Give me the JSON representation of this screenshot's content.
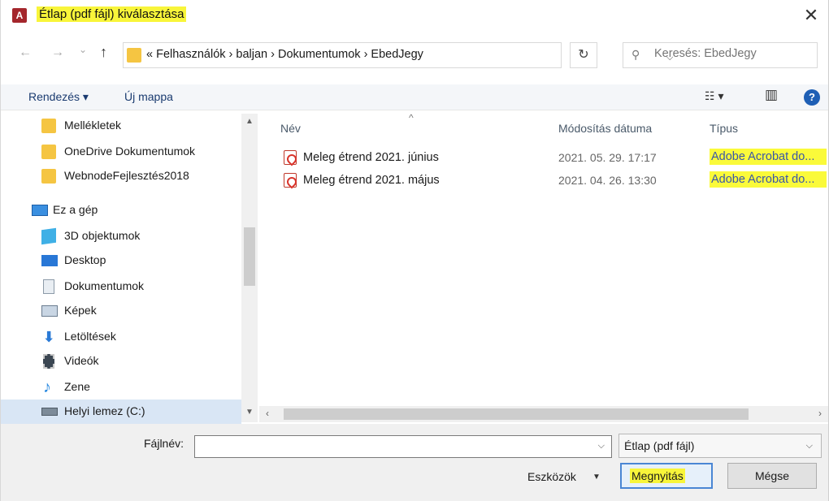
{
  "window": {
    "title": "Étlap (pdf fájl) kiválasztása",
    "app_icon_letter": "A",
    "close_glyph": "✕"
  },
  "nav": {
    "back": "←",
    "forward": "→",
    "recent": "⌄",
    "up": "↑",
    "breadcrumb": "« Felhasználók  ›  baljan  ›  Dokumentumok  ›  EbedJegy",
    "dropdown": "⌵",
    "refresh": "↻",
    "search_icon": "⚲",
    "search_placeholder": "Keresés: EbedJegy"
  },
  "toolbar": {
    "organize": "Rendezés ▾",
    "new_folder": "Új mappa",
    "view_glyph": "☷ ▾",
    "pane_glyph": "▥",
    "help": "?"
  },
  "sidebar": {
    "items": [
      {
        "label": "Mellékletek",
        "icon": "folder-icon",
        "indent": 1
      },
      {
        "label": "OneDrive Dokumentumok",
        "icon": "folder-icon",
        "indent": 1
      },
      {
        "label": "WebnodeFejlesztés2018",
        "icon": "folder-icon",
        "indent": 1
      },
      {
        "label": "Ez a gép",
        "icon": "computer-icon",
        "indent": 0
      },
      {
        "label": "3D objektumok",
        "icon": "cube-icon",
        "indent": 1
      },
      {
        "label": "Desktop",
        "icon": "desktop-icon",
        "indent": 1
      },
      {
        "label": "Dokumentumok",
        "icon": "document-icon",
        "indent": 1
      },
      {
        "label": "Képek",
        "icon": "pictures-icon",
        "indent": 1
      },
      {
        "label": "Letöltések",
        "icon": "download-icon",
        "indent": 1
      },
      {
        "label": "Videók",
        "icon": "video-icon",
        "indent": 1
      },
      {
        "label": "Zene",
        "icon": "music-icon",
        "indent": 1
      },
      {
        "label": "Helyi lemez (C:)",
        "icon": "drive-icon",
        "indent": 1,
        "selected": true
      }
    ]
  },
  "filelist": {
    "columns": {
      "name": "Név",
      "modified": "Módosítás dátuma",
      "type": "Típus"
    },
    "sort_indicator": "^",
    "rows": [
      {
        "name": "Meleg étrend 2021. június",
        "modified": "2021. 05. 29. 17:17",
        "type": "Adobe Acrobat do..."
      },
      {
        "name": "Meleg étrend 2021. május",
        "modified": "2021. 04. 26. 13:30",
        "type": "Adobe Acrobat do..."
      }
    ]
  },
  "bottom": {
    "filename_label": "Fájlnév:",
    "filename_value": "",
    "filetype_value": "Étlap (pdf fájl)",
    "tools_label": "Eszközök",
    "open_label": "Megnyitás",
    "cancel_label": "Mégse"
  },
  "colors": {
    "highlight": "#f8f53a",
    "accent": "#1e5fb5",
    "selection": "#d9e6f5"
  }
}
